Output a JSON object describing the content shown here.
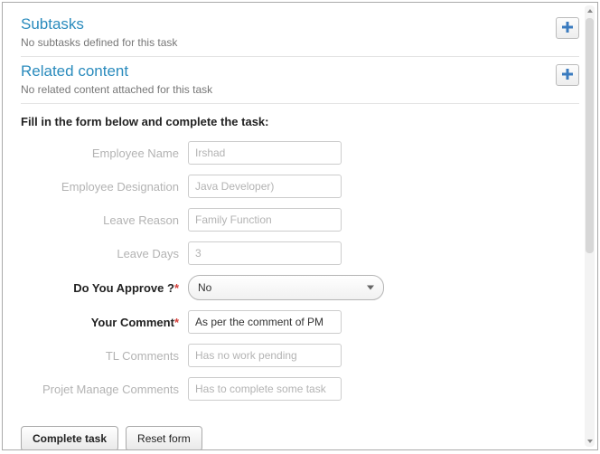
{
  "sections": {
    "subtasks": {
      "title": "Subtasks",
      "subtitle": "No subtasks defined for this task"
    },
    "related": {
      "title": "Related content",
      "subtitle": "No related content attached for this task"
    }
  },
  "form": {
    "header": "Fill in the form below and complete the task:",
    "fields": {
      "employee_name": {
        "label": "Employee Name",
        "value": "Irshad"
      },
      "employee_designation": {
        "label": "Employee Designation",
        "value": "Java Developer)"
      },
      "leave_reason": {
        "label": "Leave Reason",
        "value": "Family Function"
      },
      "leave_days": {
        "label": "Leave Days",
        "value": "3"
      },
      "approve": {
        "label": "Do You Approve ?",
        "value": "No"
      },
      "your_comment": {
        "label": "Your Comment",
        "value": "As per the comment of PM"
      },
      "tl_comments": {
        "label": "TL Comments",
        "value": "Has no work pending"
      },
      "pm_comments": {
        "label": "Projet Manage Comments",
        "value": "Has to complete some task"
      }
    },
    "required_marker": "*"
  },
  "buttons": {
    "complete": "Complete task",
    "reset": "Reset form"
  }
}
